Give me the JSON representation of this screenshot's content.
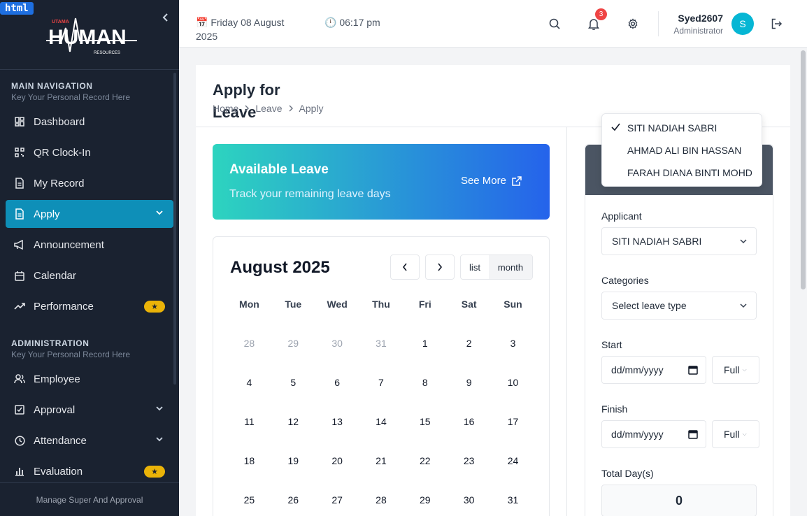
{
  "badge": {
    "label": "html"
  },
  "logo": {
    "small": "UTAMA",
    "big": "HUMAN",
    "sub": "RESOURCES"
  },
  "sidebar": {
    "main_section": {
      "title": "MAIN NAVIGATION",
      "subtitle": "Key Your Personal Record Here"
    },
    "main_items": [
      {
        "label": "Dashboard",
        "icon": "dashboard-icon"
      },
      {
        "label": "QR Clock-In",
        "icon": "qr-code-icon"
      },
      {
        "label": "My Record",
        "icon": "document-icon"
      },
      {
        "label": "Apply",
        "icon": "file-icon",
        "active": true
      },
      {
        "label": "Announcement",
        "icon": "megaphone-icon"
      },
      {
        "label": "Calendar",
        "icon": "calendar-icon"
      },
      {
        "label": "Performance",
        "icon": "trending-up-icon",
        "badge": "★"
      }
    ],
    "admin_section": {
      "title": "ADMINISTRATION",
      "subtitle": "Key Your Personal Record Here"
    },
    "admin_items": [
      {
        "label": "Employee",
        "icon": "users-icon"
      },
      {
        "label": "Approval",
        "icon": "check-square-icon"
      },
      {
        "label": "Attendance",
        "icon": "clock-icon"
      },
      {
        "label": "Evaluation",
        "icon": "bar-chart-icon",
        "badge": "★"
      }
    ],
    "footer": "Manage Super And Approval"
  },
  "topbar": {
    "date": "📅 Friday 08 August 2025",
    "time": "🕛 06:17 pm",
    "notification_count": "3",
    "user_name": "Syed2607",
    "user_role": "Administrator",
    "avatar_initial": "S"
  },
  "page": {
    "title": "Apply for Leave",
    "breadcrumb": [
      "Home",
      "Leave",
      "Apply"
    ]
  },
  "banner": {
    "title": "Available Leave",
    "subtitle": "Track your remaining leave days",
    "link": "See More"
  },
  "calendar": {
    "title": "August 2025",
    "view_list": "list",
    "view_month": "month",
    "weekdays": [
      "Mon",
      "Tue",
      "Wed",
      "Thu",
      "Fri",
      "Sat",
      "Sun"
    ],
    "weeks": [
      [
        "28",
        "29",
        "30",
        "31",
        "1",
        "2",
        "3"
      ],
      [
        "4",
        "5",
        "6",
        "7",
        "8",
        "9",
        "10"
      ],
      [
        "11",
        "12",
        "13",
        "14",
        "15",
        "16",
        "17"
      ],
      [
        "18",
        "19",
        "20",
        "21",
        "22",
        "23",
        "24"
      ],
      [
        "25",
        "26",
        "27",
        "28",
        "29",
        "30",
        "31"
      ]
    ]
  },
  "form": {
    "applicant_label": "Applicant",
    "applicant_value": "SITI NADIAH SABRI",
    "categories_label": "Categories",
    "categories_value": "Select leave type",
    "start_label": "Start",
    "start_value": "dd/mm/yyyy",
    "start_duration": "Full",
    "finish_label": "Finish",
    "finish_value": "dd/mm/yyyy",
    "finish_duration": "Full",
    "total_label": "Total Day(s)",
    "total_value": "0"
  },
  "applicant_dropdown": {
    "options": [
      "SITI NADIAH SABRI",
      "AHMAD ALI BIN HASSAN",
      "FARAH DIANA BINTI MOHD"
    ],
    "selected": "SITI NADIAH SABRI"
  },
  "colors": {
    "sidebar_bg": "#1a2230",
    "active": "#0e8fb8",
    "badge": "#eab308",
    "notification": "#ef4444"
  }
}
